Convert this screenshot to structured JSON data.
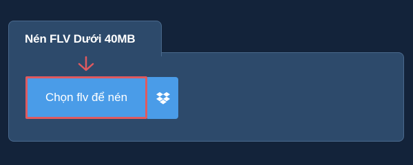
{
  "tab": {
    "title": "Nén FLV Dưới 40MB"
  },
  "upload": {
    "choose_label": "Chọn flv để nén",
    "dropbox_icon": "dropbox-icon",
    "arrow_icon": "arrow-down-icon"
  },
  "colors": {
    "background": "#13233a",
    "panel": "#2d4a6b",
    "button": "#4a9ce8",
    "highlight": "#e05a5f"
  }
}
